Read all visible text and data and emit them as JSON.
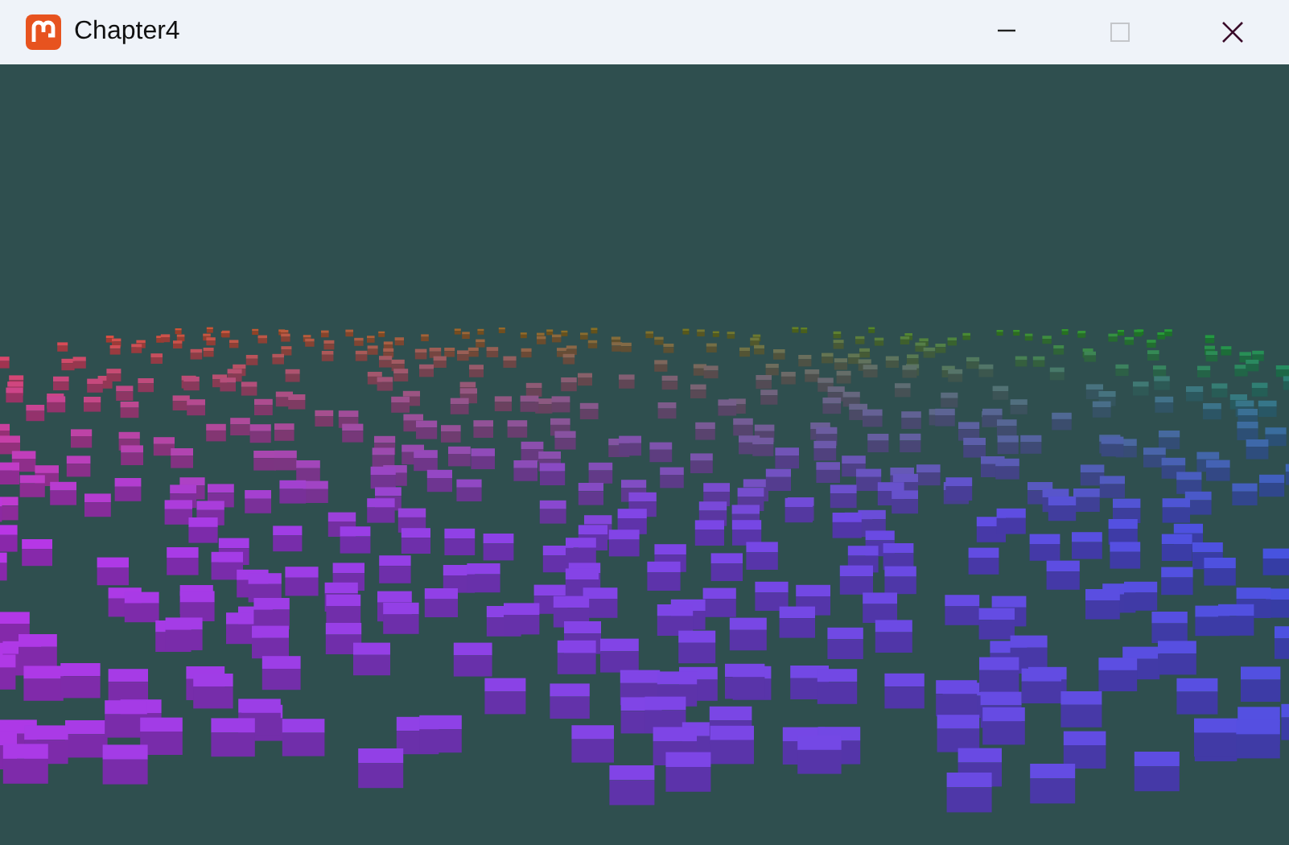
{
  "window": {
    "title": "Chapter4",
    "controls": [
      {
        "kind": "minimize",
        "disabled": false
      },
      {
        "kind": "maximize",
        "disabled": true
      },
      {
        "kind": "close",
        "disabled": false
      }
    ]
  }
}
